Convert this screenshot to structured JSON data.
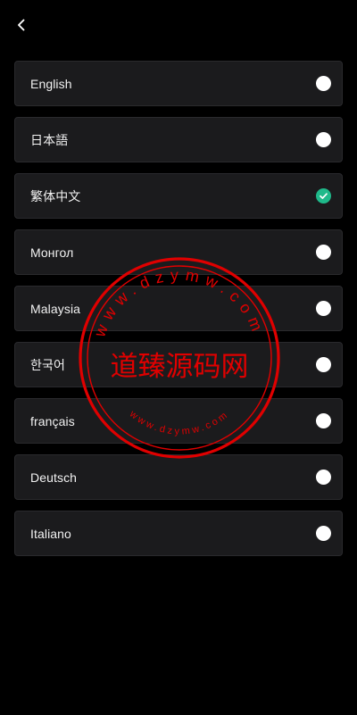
{
  "header": {
    "back_icon": "chevron-left-icon"
  },
  "languages": [
    {
      "label": "English",
      "selected": false
    },
    {
      "label": "日本語",
      "selected": false
    },
    {
      "label": "繁体中文",
      "selected": true
    },
    {
      "label": "Монгол",
      "selected": false
    },
    {
      "label": "Malaysia",
      "selected": false
    },
    {
      "label": "한국어",
      "selected": false
    },
    {
      "label": "français",
      "selected": false
    },
    {
      "label": "Deutsch",
      "selected": false
    },
    {
      "label": "Italiano",
      "selected": false
    }
  ],
  "colors": {
    "background": "#000000",
    "row_background": "#1b1b1d",
    "row_border": "#2a2a2d",
    "radio_unselected": "#ffffff",
    "radio_selected": "#1fb98a"
  },
  "watermark": {
    "center_text": "道臻源码网",
    "ring_text_top": "dzymw.com",
    "ring_text_bottom": "www.dzymw.com",
    "color": "#e00000"
  }
}
